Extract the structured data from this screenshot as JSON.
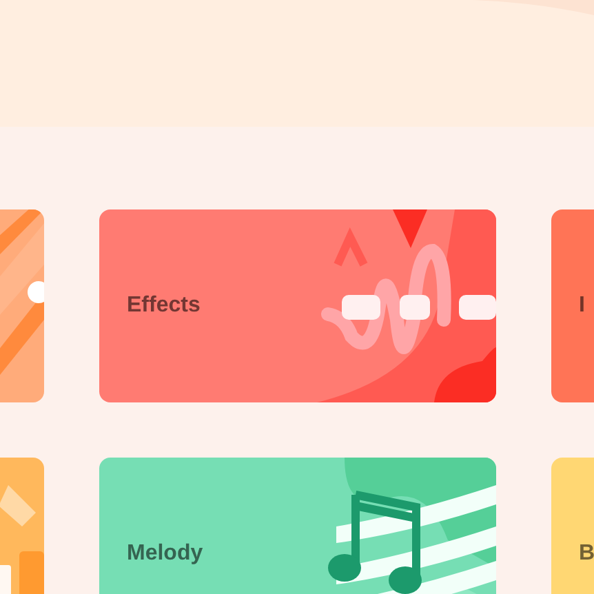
{
  "banner": {
    "kind": "curve"
  },
  "rows": [
    {
      "cards": [
        {
          "kind": "stripes",
          "color": "#ffab7a"
        },
        {
          "kind": "effects",
          "color": "#ff7b72",
          "label": "Effects"
        },
        {
          "kind": "plain",
          "color": "#ff7456",
          "label": "I"
        }
      ]
    },
    {
      "cards": [
        {
          "kind": "chart",
          "color": "#ffb85c"
        },
        {
          "kind": "melody",
          "color": "#76deb4",
          "label": "Melody"
        },
        {
          "kind": "plain",
          "color": "#ffd773",
          "label": "B"
        }
      ]
    }
  ]
}
